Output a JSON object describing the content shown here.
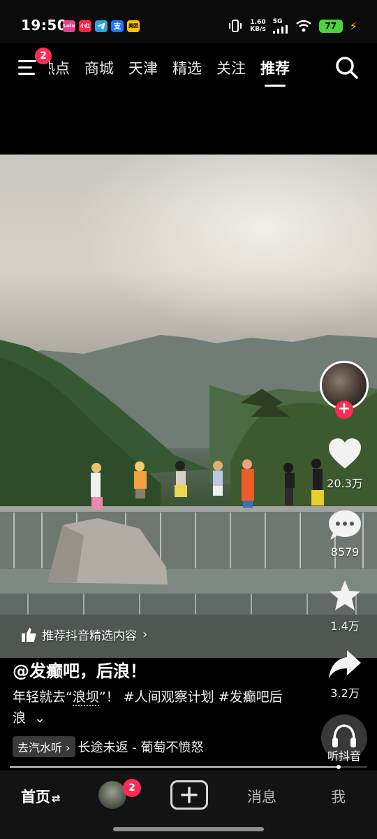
{
  "status_bar": {
    "time": "19:50",
    "app_icons": [
      {
        "name": "lulu-icon",
        "label": "Lulu",
        "color": "#e8408f"
      },
      {
        "name": "xiaohongshu-icon",
        "label": "小红书",
        "color": "#ff2442"
      },
      {
        "name": "telegram-icon",
        "label": "",
        "color": "#2aa3e0"
      },
      {
        "name": "alipay-icon",
        "label": "支",
        "color": "#1677ff"
      },
      {
        "name": "meituan-icon",
        "label": "美团",
        "color": "#ffc300"
      }
    ],
    "net_speed_value": "1.60",
    "net_speed_unit": "KB/s",
    "network": "5G",
    "battery": "77"
  },
  "top_nav": {
    "menu_badge": "2",
    "tabs": [
      {
        "label": "热点",
        "active": false
      },
      {
        "label": "商城",
        "active": false
      },
      {
        "label": "天津",
        "active": false
      },
      {
        "label": "精选",
        "active": false
      },
      {
        "label": "关注",
        "active": false
      },
      {
        "label": "推荐",
        "active": true
      }
    ]
  },
  "actions": {
    "likes": "20.3万",
    "comments": "8579",
    "favorites": "1.4万",
    "shares": "3.2万"
  },
  "recommend_label": "推荐抖音精选内容",
  "caption": {
    "author": "@发癫吧，后浪！",
    "desc_part1": "年轻就去“",
    "desc_keyword": "浪坝",
    "desc_part2": "”！ #人间观察计划 #发癫吧后浪",
    "expand": "⌄",
    "music_chip": "去汽水听",
    "music_title": "长途未返 - 葡萄不愤怒"
  },
  "listen_label": "听抖音",
  "progress": 0.92,
  "bottom_nav": {
    "home": "首页",
    "home_suffix": "⇄",
    "friends_badge": "2",
    "messages": "消息",
    "me": "我"
  }
}
